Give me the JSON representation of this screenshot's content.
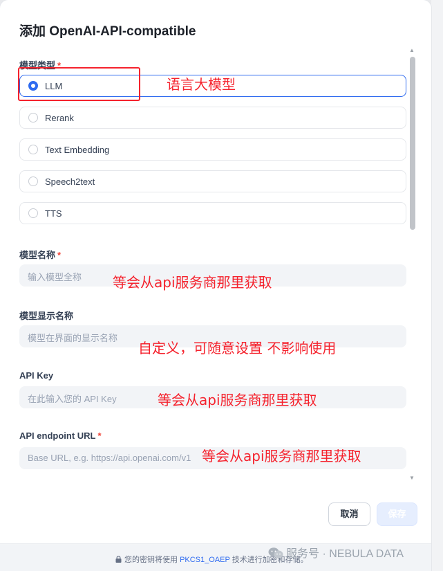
{
  "dialog": {
    "title": "添加 OpenAI-API-compatible"
  },
  "model_type": {
    "label": "模型类型",
    "required_mark": "*",
    "options": [
      {
        "label": "LLM",
        "selected": true
      },
      {
        "label": "Rerank",
        "selected": false
      },
      {
        "label": "Text Embedding",
        "selected": false
      },
      {
        "label": "Speech2text",
        "selected": false
      },
      {
        "label": "TTS",
        "selected": false
      }
    ]
  },
  "model_name": {
    "label": "模型名称",
    "required_mark": "*",
    "placeholder": "输入模型全称"
  },
  "display_name": {
    "label": "模型显示名称",
    "placeholder": "模型在界面的显示名称"
  },
  "api_key": {
    "label": "API Key",
    "placeholder": "在此输入您的 API Key"
  },
  "endpoint": {
    "label": "API endpoint URL",
    "required_mark": "*",
    "placeholder": "Base URL, e.g. https://api.openai.com/v1"
  },
  "annotations": {
    "llm_note": "语言大模型",
    "model_name_note": "等会从api服务商那里获取",
    "display_name_note": "自定义，可随意设置 不影响使用",
    "api_key_note": "等会从api服务商那里获取",
    "endpoint_note": "等会从api服务商那里获取"
  },
  "actions": {
    "cancel_label": "取消",
    "save_label": "保存"
  },
  "footer": {
    "text_before": "您的密钥将使用",
    "link": "PKCS1_OAEP",
    "text_after": "技术进行加密和存储。"
  },
  "watermark": {
    "text": "服务号 · NEBULA DATA"
  },
  "colors": {
    "accent": "#2f6bf0",
    "annotation_red": "#f5222d",
    "required": "#f04438"
  }
}
